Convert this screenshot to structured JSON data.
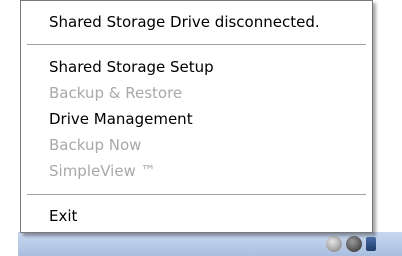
{
  "menu": {
    "header": "Shared Storage Drive disconnected.",
    "items": [
      {
        "label": "Shared Storage Setup",
        "enabled": true
      },
      {
        "label": "Backup & Restore",
        "enabled": false
      },
      {
        "label": "Drive Management",
        "enabled": true
      },
      {
        "label": "Backup Now",
        "enabled": false
      },
      {
        "label": "SimpleView ™",
        "enabled": false
      }
    ],
    "exit": "Exit"
  },
  "tray": {
    "icons": [
      "gray-circle-icon",
      "dark-circle-icon",
      "blue-device-icon"
    ]
  },
  "colors": {
    "enabled_text": "#000000",
    "disabled_text": "#a9a9a9",
    "separator": "#a0a0a0"
  }
}
